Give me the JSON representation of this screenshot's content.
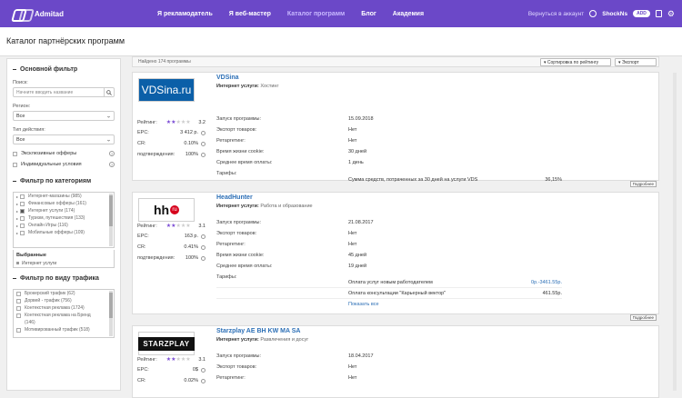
{
  "header": {
    "brand": "Admitad",
    "nav": [
      "Я рекламодатель",
      "Я веб-мастер",
      "Каталог программ",
      "Блог",
      "Академия"
    ],
    "back": "Вернуться в аккаунт",
    "user": "ShockNs",
    "badge": "ADD"
  },
  "page_title": "Каталог партнёрских программ",
  "sidebar": {
    "main_filter": "Основной фильтр",
    "search_label": "Поиск:",
    "search_placeholder": "Начните вводить название",
    "region_label": "Регион:",
    "region_value": "Все",
    "action_label": "Тип действия:",
    "action_value": "Все",
    "exclusive": "Эксклюзивные офферы",
    "individual": "Индивидуальные условия",
    "cat_filter": "Фильтр по категориям",
    "categories": [
      "Интернет-магазины (985)",
      "Финансовые офферы (161)",
      "Интернет услуги (174)",
      "Туризм, путешествия (133)",
      "Онлайн Игры (116)",
      "Мобильные офферы (109)"
    ],
    "chosen_title": "Выбранные",
    "chosen_item": "Интернет услуги",
    "traffic_filter": "Фильтр по виду трафика",
    "traffic": [
      "Брокерский трафик (62)",
      "Дорвей - трафик (756)",
      "Контекстная реклама (1724)",
      "Контекстная реклама на Бренд",
      "(146)",
      "Мотивированный трафик (518)"
    ]
  },
  "toolbar": {
    "found": "Найдено 174 программы",
    "sort": "Сортировка по рейтингу",
    "export": "Экспорт"
  },
  "labels": {
    "rating": "Рейтинг:",
    "epc": "EPC:",
    "cr": "CR:",
    "confirm": "подтверждения:",
    "service": "Интернет услуги:",
    "launch": "Запуск программы:",
    "export": "Экспорт товаров:",
    "retarget": "Ретаргетинг:",
    "cookie": "Время жизни cookie:",
    "avg_pay": "Среднее время оплаты:",
    "tariffs": "Тарифы:",
    "details": "Подробнее"
  },
  "cards": [
    {
      "name": "VDSina",
      "category": "Хостинг",
      "rating": "3.2",
      "epc": "3 412 р.",
      "cr": "0.10%",
      "confirm": "100%",
      "launch": "15.09.2018",
      "export": "Нет",
      "retarget": "Нет",
      "cookie": "30 дней",
      "avg_pay": "1 день",
      "tariff_name": "Сумма средств, потраченных за 30 дней на услуги VDS",
      "tariff_value": "36,15%"
    },
    {
      "name": "HeadHunter",
      "category": "Работа и образование",
      "rating": "3.1",
      "epc": "163 р.",
      "cr": "0.41%",
      "confirm": "100%",
      "launch": "21.08.2017",
      "export": "Нет",
      "retarget": "Нет",
      "cookie": "45 дней",
      "avg_pay": "19 дней",
      "tariff1": "Оплата услуг новым работодателем",
      "tariff1_value": "0р.-3461.55р.",
      "tariff2": "Оплата консультации \"Карьерный вектор\"",
      "tariff2_value": "461.55р.",
      "show_all": "Показать все"
    },
    {
      "name": "Starzplay AE BH KW MA SA",
      "category": "Развлечения и досуг",
      "rating": "3.1",
      "epc": "0$",
      "cr": "0.02%",
      "launch": "18.04.2017",
      "export": "Нет",
      "retarget": "Нет"
    }
  ]
}
